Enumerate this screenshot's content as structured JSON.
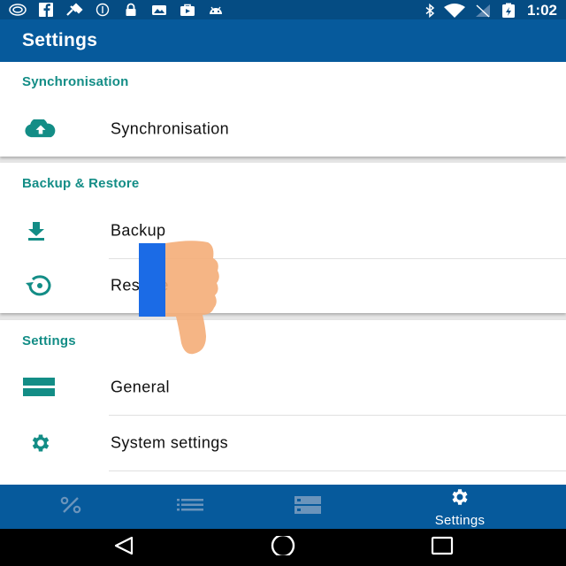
{
  "status_bar": {
    "time": "1:02",
    "left_icons": [
      "app-icon",
      "facebook-icon",
      "satellite-icon",
      "data-saver-icon",
      "lock-icon",
      "photo-icon",
      "shop-icon",
      "android-icon"
    ],
    "right_icons": [
      "bluetooth-icon",
      "wifi-icon",
      "signal-icon",
      "battery-icon"
    ]
  },
  "app_bar": {
    "title": "Settings"
  },
  "sections": [
    {
      "header": "Synchronisation",
      "items": [
        {
          "label": "Synchronisation",
          "icon": "cloud-upload-icon"
        }
      ]
    },
    {
      "header": "Backup & Restore",
      "items": [
        {
          "label": "Backup",
          "icon": "download-icon"
        },
        {
          "label": "Restore",
          "icon": "restore-icon"
        }
      ]
    },
    {
      "header": "Settings",
      "items": [
        {
          "label": "General",
          "icon": "general-icon"
        },
        {
          "label": "System settings",
          "icon": "gear-icon"
        }
      ]
    }
  ],
  "bottom_nav": {
    "items": [
      {
        "icon": "percent-icon",
        "label": ""
      },
      {
        "icon": "list-icon",
        "label": ""
      },
      {
        "icon": "storage-icon",
        "label": ""
      },
      {
        "icon": "gear-icon",
        "label": "Settings"
      }
    ],
    "selected": 3
  },
  "system_nav": {
    "buttons": [
      "back-icon",
      "home-icon",
      "recents-icon"
    ]
  },
  "overlay": {
    "icon": "thumbs-down-icon"
  },
  "colors": {
    "primary": "#065a9c",
    "status_bar": "#054c83",
    "accent": "#138d86",
    "background": "#e6e6e6"
  }
}
